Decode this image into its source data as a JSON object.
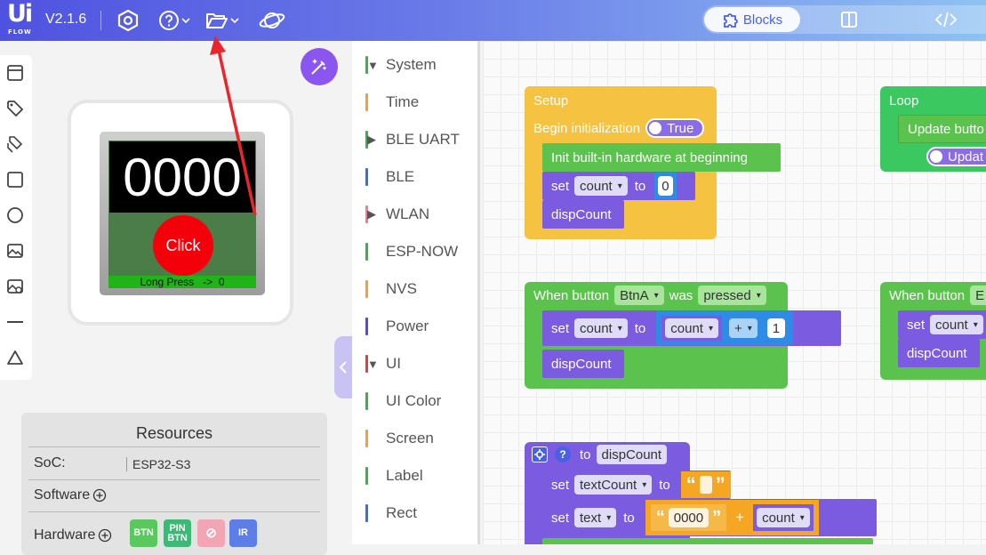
{
  "header": {
    "logo_main": "Ui",
    "logo_sub": "FLOW",
    "version": "V2.1.6",
    "icons": [
      "settings-hex-icon",
      "help-icon",
      "folder-open-icon",
      "planet-icon"
    ],
    "view_tabs": [
      {
        "label": "Blocks",
        "active": true,
        "icon": "puzzle-icon"
      },
      {
        "label": "",
        "active": false,
        "icon": "split-view-icon"
      },
      {
        "label": "",
        "active": false,
        "icon": "code-icon"
      }
    ]
  },
  "device": {
    "counter": "0000",
    "button_label": "Click",
    "status_line": "Long Press   ->  0"
  },
  "resources": {
    "title": "Resources",
    "soc_label": "SoC:",
    "soc_value": "ESP32-S3",
    "software_label": "Software",
    "hardware_label": "Hardware",
    "hardware_badges": [
      {
        "label": "BTN",
        "color": "#5bc85f"
      },
      {
        "label": "PIN BTN",
        "color": "#3fb777"
      },
      {
        "label": "⊘",
        "color": "#f2a6b5"
      },
      {
        "label": "IR",
        "color": "#5d7ee6"
      }
    ]
  },
  "toolbox": {
    "categories": [
      {
        "label": "System",
        "color": "#3cb04a",
        "expandable": true,
        "expanded": true
      },
      {
        "label": "Time",
        "color": "#f2a13a",
        "expandable": false
      },
      {
        "label": "BLE UART",
        "color": "#3cb04a",
        "expandable": true,
        "expanded": false
      },
      {
        "label": "BLE",
        "color": "#2f74d8",
        "expandable": false
      },
      {
        "label": "WLAN",
        "color": "#ee7d93",
        "expandable": true,
        "expanded": false
      },
      {
        "label": "ESP-NOW",
        "color": "#3cb04a",
        "expandable": false
      },
      {
        "label": "NVS",
        "color": "#f2a13a",
        "expandable": false
      },
      {
        "label": "Power",
        "color": "#5a49d8",
        "expandable": false
      },
      {
        "label": "UI",
        "color": "#e0403e",
        "expandable": true,
        "expanded": true
      },
      {
        "label": "UI Color",
        "color": "#3cb04a",
        "expandable": false
      },
      {
        "label": "Screen",
        "color": "#f2a13a",
        "expandable": false
      },
      {
        "label": "Label",
        "color": "#3cb04a",
        "expandable": false
      },
      {
        "label": "Rect",
        "color": "#2f74d8",
        "expandable": false
      }
    ]
  },
  "workspace": {
    "setup": {
      "title": "Setup",
      "begin_label": "Begin initialization",
      "begin_toggle": "True",
      "init_label": "Init built-in hardware at beginning",
      "set_label": "set",
      "var": "count",
      "to_label": "to",
      "value": "0",
      "call": "dispCount"
    },
    "loop": {
      "title": "Loop",
      "update_label": "Update butto",
      "update_toggle": "Updat"
    },
    "button_a": {
      "when_label": "When button",
      "button": "BtnA",
      "was_label": "was",
      "event": "pressed",
      "set_label": "set",
      "var": "count",
      "to_label": "to",
      "operand_var": "count",
      "operator": "+",
      "operand_num": "1",
      "call": "dispCount"
    },
    "button_b": {
      "when_label": "When button",
      "button": "E",
      "set_label": "set",
      "var": "count",
      "call": "dispCount"
    },
    "func": {
      "to_label": "to",
      "name": "dispCount",
      "set1_label": "set",
      "var1": "textCount",
      "to1_label": "to",
      "quote_open": "“",
      "quote_close": "”",
      "set2_label": "set",
      "var2": "text",
      "to2_label": "to",
      "str": "0000",
      "plus": "+",
      "var3": "count"
    }
  },
  "colors": {
    "setup_orange": "#f5c242",
    "loop_green": "#3cc860",
    "button_green": "#5cc24e",
    "var_purple": "#7b5ce0",
    "math_blue": "#2f8be6",
    "text_orange": "#f5a623",
    "func_purple": "#7b5ce0",
    "arrow_red": "#e8262b"
  }
}
